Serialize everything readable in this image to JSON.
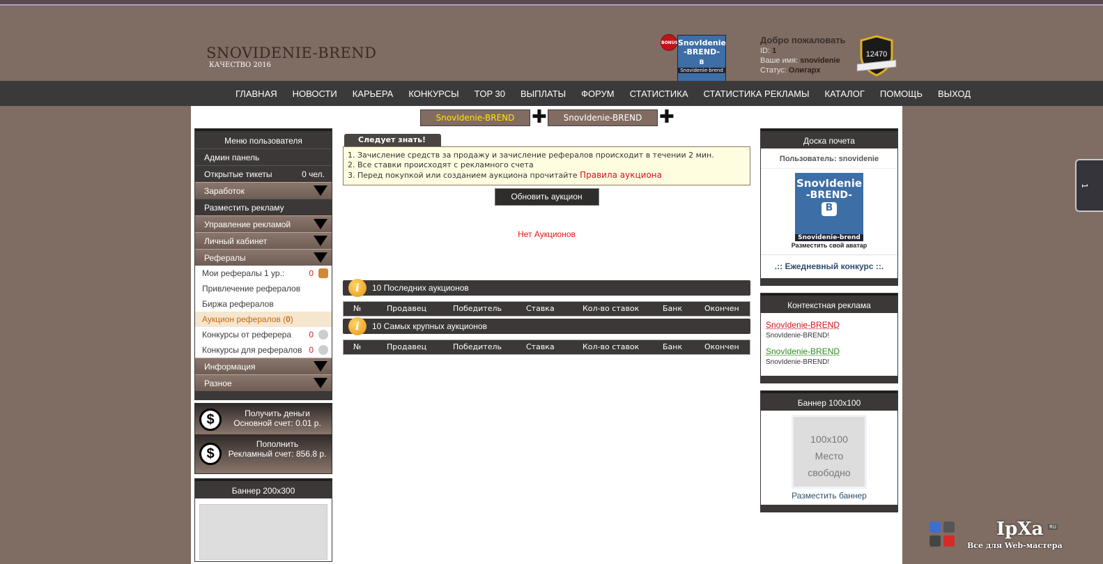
{
  "header": {
    "site_title": "SNOVIDENIE-BREND",
    "site_subtitle": "КАЧЕСТВО 2016",
    "bonus_label": "BONUS",
    "vk_logo": {
      "line1": "SnovIdenie",
      "line2": "-BREND-",
      "letter": "B",
      "caption": "Snovidenie-brend"
    },
    "welcome": "Добро пожаловать",
    "id_label": "ID:",
    "id_value": "1",
    "name_label": "Ваше имя:",
    "name_value": "snovidenie",
    "status_label": "Статус:",
    "status_value": "Олигарх",
    "rating": "12470"
  },
  "nav": [
    "ГЛАВНАЯ",
    "НОВОСТИ",
    "КАРЬЕРА",
    "КОНКУРСЫ",
    "TOP 30",
    "ВЫПЛАТЫ",
    "ФОРУМ",
    "СТАТИСТИКА",
    "СТАТИСТИКА РЕКЛАМЫ",
    "КАТАЛОГ",
    "ПОМОЩЬ",
    "ВЫХОД"
  ],
  "brand_tabs": [
    "SnovIdenie-BREND",
    "SnovIdenie-BREND"
  ],
  "plus_glyph": "✚",
  "user_menu": {
    "title": "Меню пользователя",
    "admin": "Админ панель",
    "tickets": "Открытые тикеты",
    "tickets_count": "0 чел.",
    "earnings": "Заработок",
    "place_ad": "Разместить рекламу",
    "manage_ads": "Управление рекламой",
    "cabinet": "Личный кабинет",
    "referrals": "Рефералы",
    "sub": {
      "my_refs": "Мои рефералы 1 ур.:",
      "my_refs_count": "0",
      "attract": "Привлечение рефералов",
      "exchange": "Биржа рефералов",
      "auction": "Аукцион рефералов (",
      "auction_count": "0",
      "auction_close": ")",
      "contests_from": "Конкурсы от реферера",
      "contests_from_count": "0",
      "contests_for": "Конкурсы для рефералов",
      "contests_for_count": "0"
    },
    "info": "Информация",
    "misc": "Разное"
  },
  "money": {
    "icon": "$",
    "withdraw_title": "Получить деньги",
    "withdraw_line": "Основной счет: 0.01 р.",
    "topup_title": "Пополнить",
    "topup_line": "Рекламный счет: 856.8 р."
  },
  "banner200_title": "Баннер 200x300",
  "notice": {
    "tab": "Следует знать!",
    "line1": "1. Зачисление средств за продажу и зачисление рефералов происходит в течении 2 мин.",
    "line2": "2. Все ставки происходят с рекламного счета",
    "line3": "3. Перед покупкой или созданием аукциона прочитайте ",
    "rules_link": "Правила аукциона"
  },
  "refresh_button": "Обновить аукцион",
  "no_auctions": "Нет Аукционов",
  "info_icon": "i",
  "last_auctions_title": "10 Последних аукционов",
  "largest_auctions_title": "10 Самых крупных аукционов",
  "table_columns": [
    "№",
    "Продавец",
    "Победитель",
    "Ставка",
    "Кол-во ставок",
    "Банк",
    "Окончен"
  ],
  "honor": {
    "title": "Доска почета",
    "user_label": "Пользователь: snovidenie",
    "avatar_caption": "Разместить свой аватар",
    "contest": ".:: Ежедневный конкурс ::."
  },
  "context_ads": {
    "title": "Контекстная реклама",
    "ad1_link": "SnovIdenie-BREND",
    "ad1_text": "SnovIdenie-BREND!",
    "ad2_link": "SnovIdenie-BREND",
    "ad2_text": "SnovIdenie-BREND!"
  },
  "banner100": {
    "title": "Баннер 100x100",
    "l1": "100x100",
    "l2": "Место",
    "l3": "свободно",
    "link": "Разместить баннер"
  },
  "side_tab": "1",
  "ipxa": {
    "logo": "IpXa",
    "ru": "RU",
    "sub": "Все для Web-мастера"
  }
}
